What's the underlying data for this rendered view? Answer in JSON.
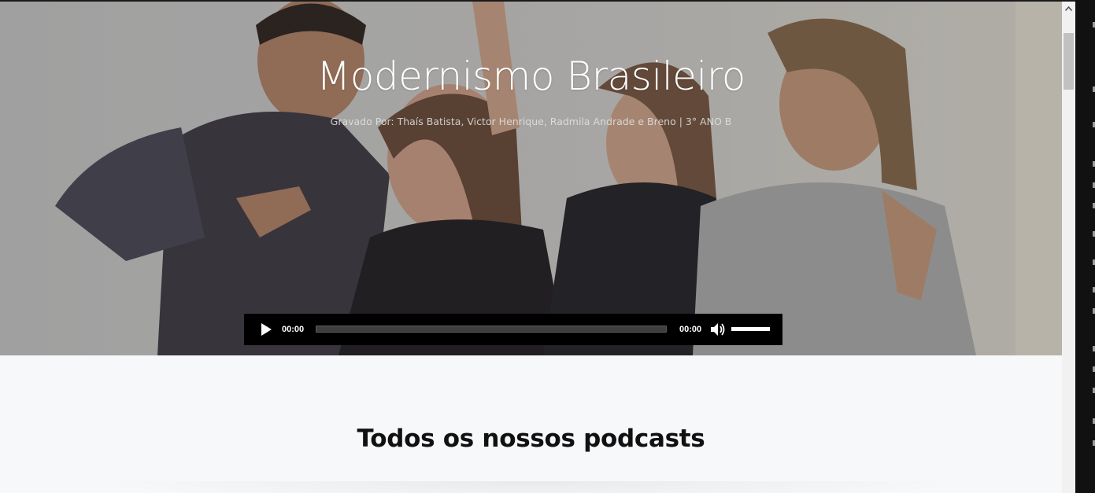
{
  "hero": {
    "title": "Modernismo Brasileiro",
    "subtitle": "Gravado Por: Thaís Batista, Victor Henrique, Radmila Andrade e Breno | 3° ANO B"
  },
  "player": {
    "current_time": "00:00",
    "duration": "00:00",
    "progress": 0,
    "volume": 1.0,
    "play_icon": "play-icon",
    "volume_icon": "speaker-icon"
  },
  "main": {
    "heading": "Todos os nossos podcasts"
  },
  "colors": {
    "player_bg": "#000000",
    "section_bg": "#f7f8fa",
    "heading_color": "#111111"
  }
}
